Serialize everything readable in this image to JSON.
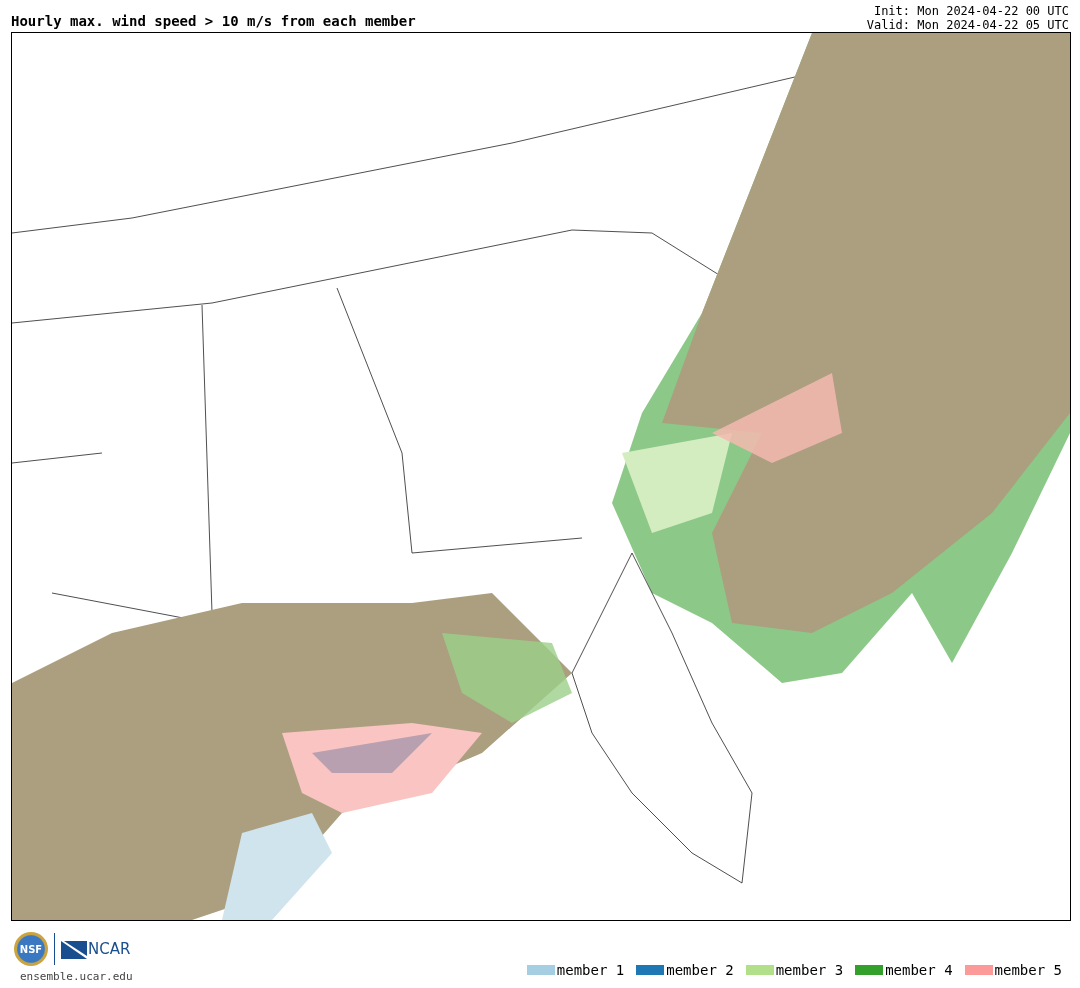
{
  "title": "Hourly max. wind speed > 10 m/s from each member",
  "init": "Init: Mon 2024-04-22 00 UTC",
  "valid": "Valid: Mon 2024-04-22 05 UTC",
  "footer": {
    "site": "ensemble.ucar.edu",
    "org_logo": "NSF",
    "lab_logo": "NCAR"
  },
  "legend": [
    {
      "label": "member 1",
      "color": "#a6cee3"
    },
    {
      "label": "member 2",
      "color": "#1f78b4"
    },
    {
      "label": "member 3",
      "color": "#b2df8a"
    },
    {
      "label": "member 4",
      "color": "#33a02c"
    },
    {
      "label": "member 5",
      "color": "#fb9a99"
    }
  ]
}
